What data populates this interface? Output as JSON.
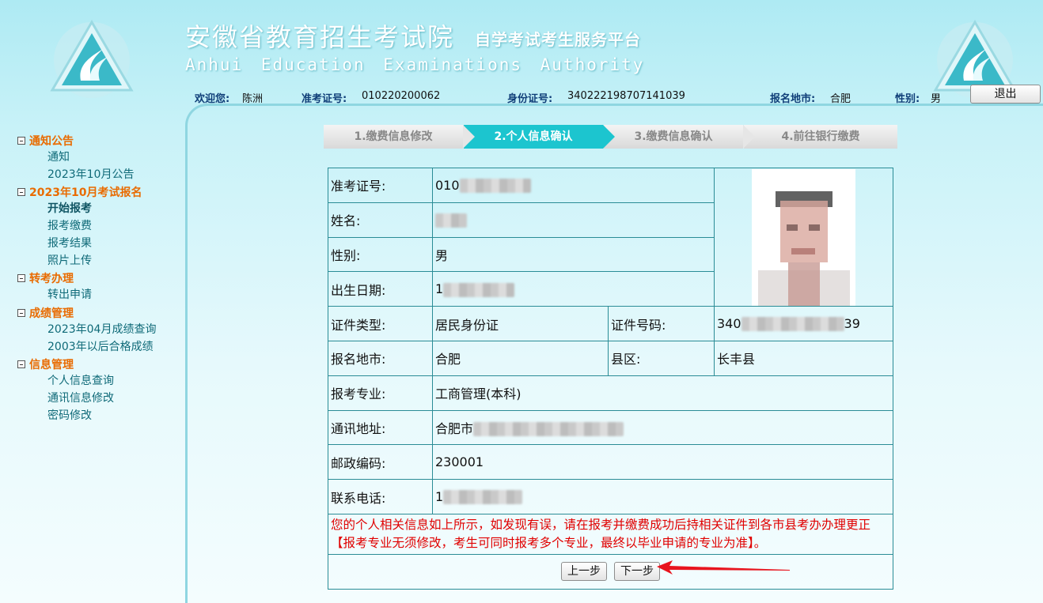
{
  "header": {
    "title_cn": "安徽省教育招生考试院",
    "subtitle_cn": "自学考试考生服务平台",
    "title_en": "Anhui Education Examinations Authority",
    "logo_icon": "aeea-triangle-logo-icon",
    "welcome_label": "欢迎您:",
    "welcome_value": "陈洲",
    "ticket_label": "准考证号:",
    "ticket_value": "010220200062",
    "id_label": "身份证号:",
    "id_value": "340222198707141039",
    "city_label": "报名地市:",
    "city_value": "合肥",
    "gender_label": "性别:",
    "gender_value": "男",
    "logout_label": "退出"
  },
  "sidebar": {
    "groups": [
      {
        "label": "通知公告",
        "items": [
          "通知",
          "2023年10月公告"
        ]
      },
      {
        "label": "2023年10月考试报名",
        "items": [
          "开始报考",
          "报考缴费",
          "报考结果",
          "照片上传"
        ]
      },
      {
        "label": "转考办理",
        "items": [
          "转出申请"
        ]
      },
      {
        "label": "成绩管理",
        "items": [
          "2023年04月成绩查询",
          "2003年以后合格成绩"
        ]
      },
      {
        "label": "信息管理",
        "items": [
          "个人信息查询",
          "通讯信息修改",
          "密码修改"
        ]
      }
    ],
    "active_item": "开始报考"
  },
  "steps": [
    {
      "label": "1.缴费信息修改",
      "active": false
    },
    {
      "label": "2.个人信息确认",
      "active": true
    },
    {
      "label": "3.缴费信息确认",
      "active": false
    },
    {
      "label": "4.前往银行缴费",
      "active": false
    }
  ],
  "form": {
    "ticket_label": "准考证号:",
    "ticket_value": "010",
    "name_label": "姓名:",
    "gender_label": "性别:",
    "gender_value": "男",
    "birth_label": "出生日期:",
    "birth_value": "1",
    "doc_type_label": "证件类型:",
    "doc_type_value": "居民身份证",
    "doc_no_label": "证件号码:",
    "doc_no_prefix": "340",
    "doc_no_suffix": "39",
    "city_label": "报名地市:",
    "city_value": "合肥",
    "county_label": "县区:",
    "county_value": "长丰县",
    "major_label": "报考专业:",
    "major_value": "工商管理(本科)",
    "address_label": "通讯地址:",
    "address_value": "合肥市",
    "postcode_label": "邮政编码:",
    "postcode_value": "230001",
    "phone_label": "联系电话:",
    "phone_value": "1",
    "notice": "您的个人相关信息如上所示，如发现有误，请在报考并缴费成功后持相关证件到各市县考办办理更正【报考专业无须修改，考生可同时报考多个专业，最终以毕业申请的专业为准】。",
    "prev_label": "上一步",
    "next_label": "下一步"
  },
  "colors": {
    "accent": "#1cc5cf",
    "sidebar_group": "#e96b00",
    "sidebar_item": "#0f6a78",
    "table_border": "#2a8c96",
    "notice": "#e00000",
    "annotation_arrow": "#e8141e"
  }
}
